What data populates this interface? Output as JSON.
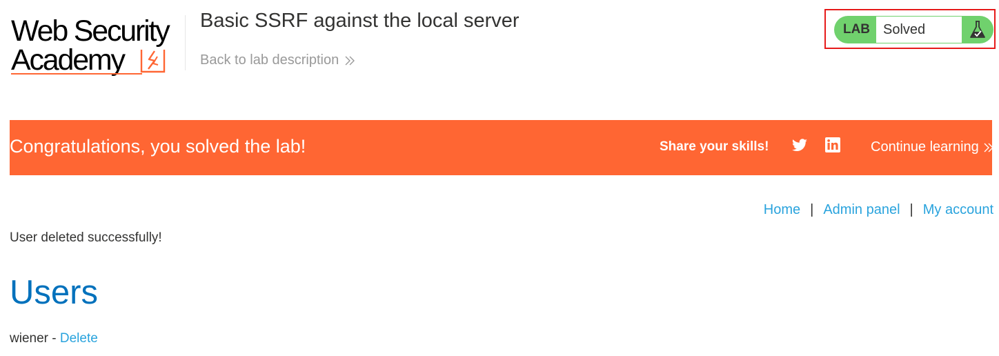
{
  "header": {
    "logo_line1": "Web Security",
    "logo_line2": "Academy",
    "lab_title": "Basic SSRF against the local server",
    "back_link": "Back to lab description"
  },
  "lab_status": {
    "label": "LAB",
    "status": "Solved",
    "icon": "flask-icon"
  },
  "banner": {
    "message": "Congratulations, you solved the lab!",
    "share_label": "Share your skills!",
    "twitter_icon": "twitter-icon",
    "linkedin_icon": "linkedin-icon",
    "continue_label": "Continue learning"
  },
  "nav": {
    "links": [
      "Home",
      "Admin panel",
      "My account"
    ],
    "separator": "|"
  },
  "main": {
    "flash_message": "User deleted successfully!",
    "heading": "Users",
    "users": [
      {
        "username": "wiener",
        "separator": " - ",
        "action": "Delete"
      }
    ]
  },
  "colors": {
    "brand_orange": "#ff6633",
    "link_blue": "#29a3dd",
    "heading_blue": "#0071bc",
    "solved_green": "#70d16d",
    "highlight_red": "#e61919"
  }
}
